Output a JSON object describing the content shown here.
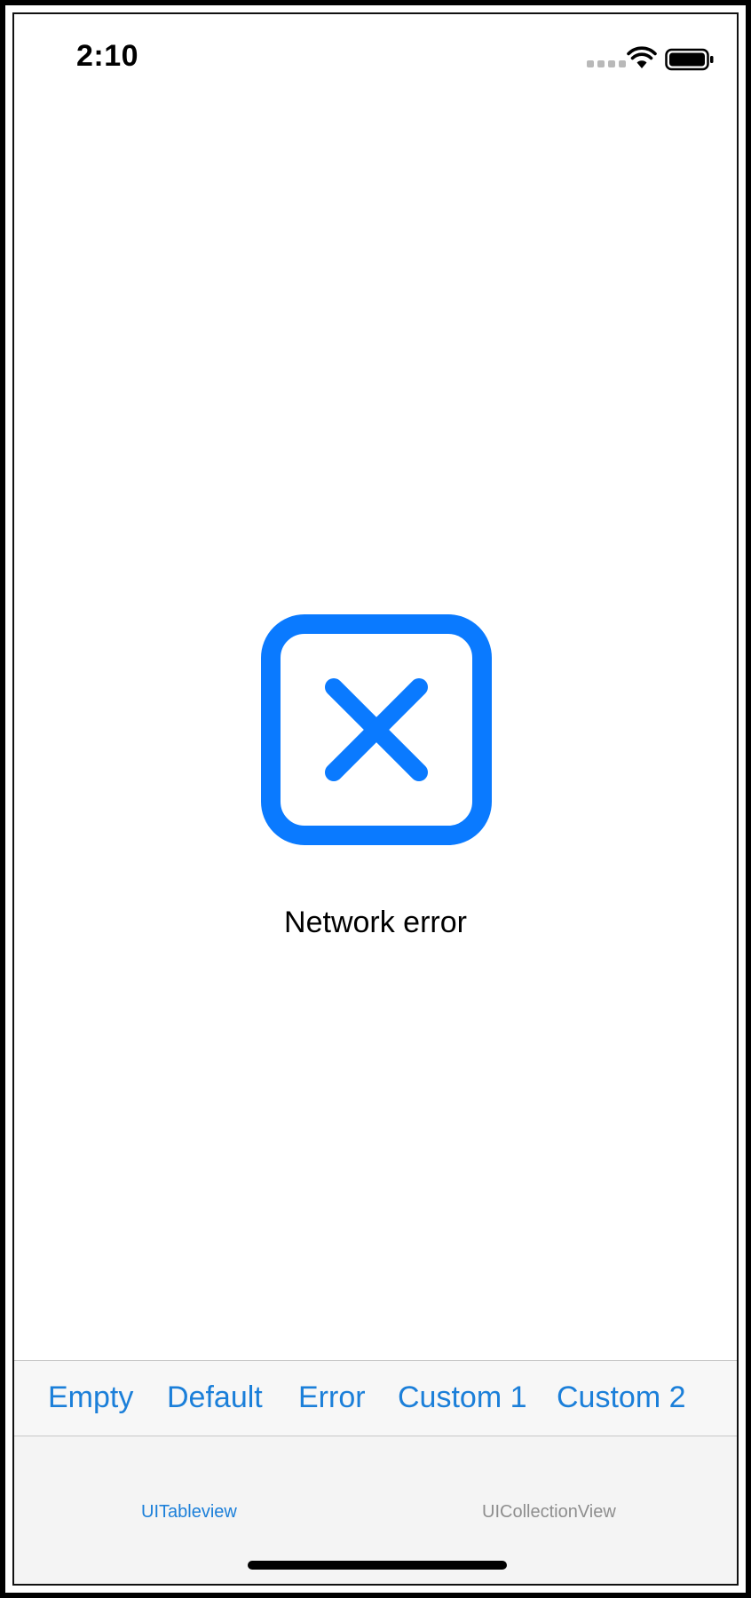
{
  "status_bar": {
    "time": "2:10"
  },
  "content": {
    "icon": "xmark-square-icon",
    "message": "Network error",
    "accent_color": "#0a7aff"
  },
  "state_toolbar": {
    "buttons": [
      {
        "label": "Empty"
      },
      {
        "label": "Default"
      },
      {
        "label": "Error"
      },
      {
        "label": "Custom 1"
      },
      {
        "label": "Custom 2"
      }
    ]
  },
  "tab_bar": {
    "tabs": [
      {
        "label": "UITableview",
        "selected": true
      },
      {
        "label": "UICollectionView",
        "selected": false
      }
    ]
  }
}
